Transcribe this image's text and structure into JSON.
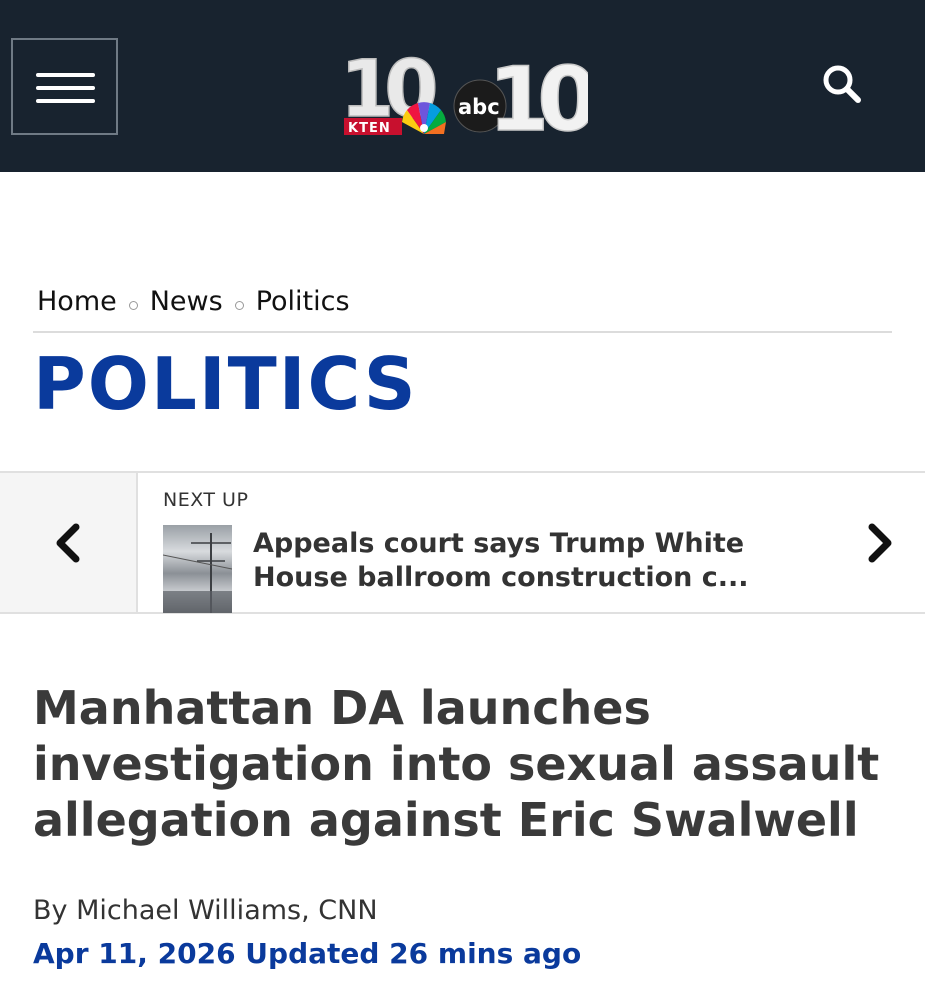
{
  "header": {
    "logo_texts": [
      "10",
      "KTEN",
      "abc",
      "10"
    ],
    "colors": {
      "background": "#18232f",
      "accent": "#0a3a9c"
    },
    "icons": {
      "menu": "hamburger-menu-icon",
      "search": "search-icon"
    }
  },
  "breadcrumb": {
    "items": [
      "Home",
      "News",
      "Politics"
    ]
  },
  "section": {
    "title": "POLITICS"
  },
  "next_up": {
    "label": "NEXT UP",
    "title": "Appeals court says Trump White House ballroom construction c...",
    "icons": {
      "prev": "chevron-left-icon",
      "next": "chevron-right-icon"
    }
  },
  "article": {
    "headline": "Manhattan DA launches investigation into sexual assault allegation against Eric Swalwell",
    "byline": "By Michael Williams, CNN",
    "date": "Apr 11, 2026 Updated 26 mins ago"
  }
}
